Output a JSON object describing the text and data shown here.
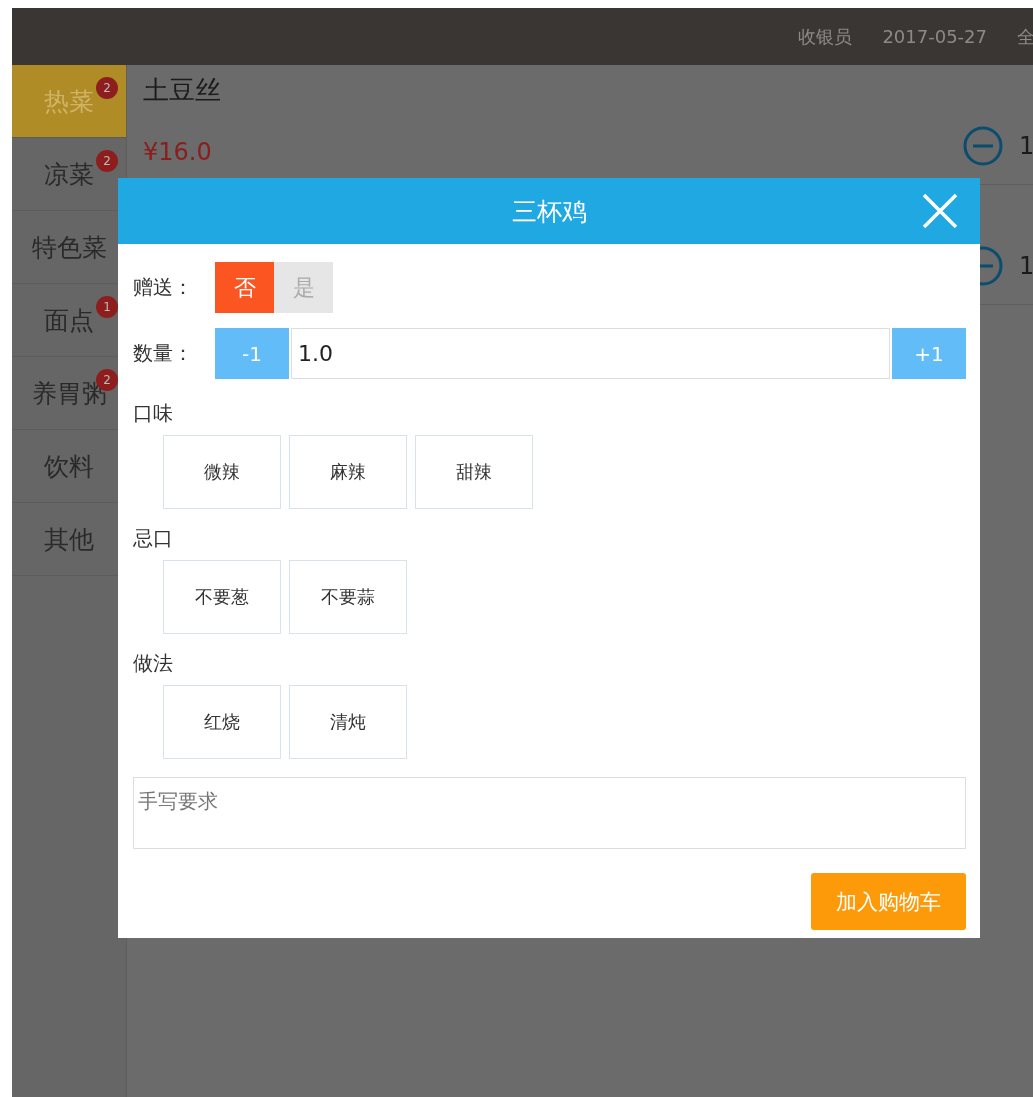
{
  "top_bar": {
    "cashier": "收银员",
    "date": "2017-05-27",
    "column_3": "全"
  },
  "categories": [
    {
      "label": "热菜",
      "badge": "2",
      "selected": true
    },
    {
      "label": "凉菜",
      "badge": "2",
      "selected": false
    },
    {
      "label": "特色菜",
      "selected": false
    },
    {
      "label": "面点",
      "badge": "1",
      "selected": false
    },
    {
      "label": "养胃粥",
      "badge": "2",
      "selected": false
    },
    {
      "label": "饮料",
      "selected": false
    },
    {
      "label": "其他",
      "selected": false
    }
  ],
  "dishes": [
    {
      "name": "土豆丝",
      "price": "¥16.0",
      "quantity": "1"
    },
    {
      "quantity": "1"
    }
  ],
  "dialog": {
    "title": "三杯鸡",
    "gift": {
      "label": "赠送：",
      "options": [
        {
          "label": "否",
          "selected": true
        },
        {
          "label": "是",
          "selected": false
        }
      ]
    },
    "quantity": {
      "label": "数量：",
      "minus": "-1",
      "value": "1.0",
      "plus": "+1"
    },
    "option_groups": [
      {
        "title": "口味",
        "options": [
          {
            "label": "微辣",
            "selected": false
          },
          {
            "label": "麻辣",
            "selected": false
          },
          {
            "label": "甜辣",
            "selected": false
          }
        ]
      },
      {
        "title": "忌口",
        "options": [
          {
            "label": "不要葱",
            "selected": false
          },
          {
            "label": "不要蒜",
            "selected": false
          }
        ]
      },
      {
        "title": "做法",
        "options": [
          {
            "label": "红烧",
            "selected": false
          },
          {
            "label": "清炖",
            "selected": false
          }
        ]
      }
    ],
    "note": {
      "placeholder": "手写要求"
    },
    "add_button": "加入购物车"
  }
}
